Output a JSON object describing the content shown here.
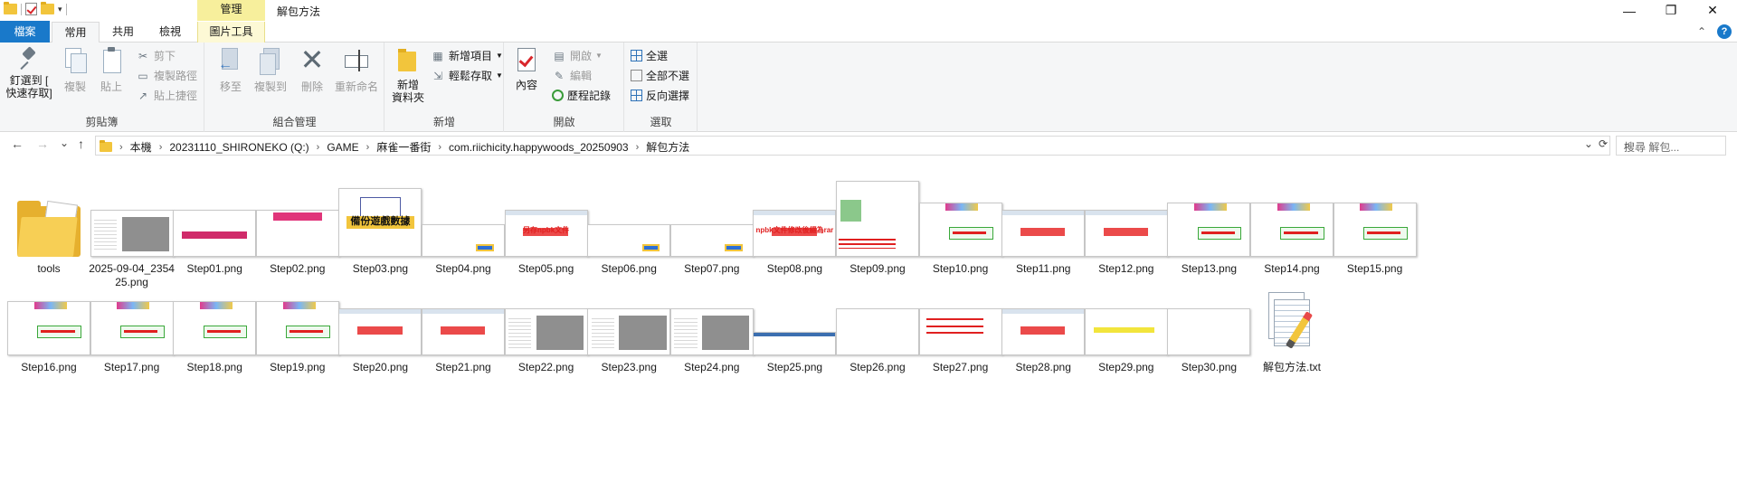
{
  "titlebar": {
    "context_tab": "管理",
    "title": "解包方法",
    "qat_dropdown": "▾",
    "minimize": "—",
    "maximize": "❐",
    "close": "✕"
  },
  "tabs": {
    "file": "檔案",
    "home": "常用",
    "share": "共用",
    "view": "檢視",
    "picture_tools": "圖片工具",
    "collapse": "⌃",
    "help": "?"
  },
  "ribbon": {
    "clipboard": {
      "label": "剪貼簿",
      "pin": "釘選到 [ 快速存取]",
      "copy": "複製",
      "paste": "貼上",
      "cut": "剪下",
      "copy_path": "複製路徑",
      "paste_shortcut": "貼上捷徑"
    },
    "organize": {
      "label": "組合管理",
      "move_to": "移至",
      "copy_to": "複製到",
      "delete": "刪除",
      "rename": "重新命名"
    },
    "new": {
      "label": "新增",
      "new_folder": "新增 資料夾",
      "new_item": "新增項目",
      "easy_access": "輕鬆存取"
    },
    "open": {
      "label": "開啟",
      "properties": "內容",
      "open": "開啟",
      "edit": "編輯",
      "history": "歷程記錄"
    },
    "select": {
      "label": "選取",
      "select_all": "全選",
      "select_none": "全部不選",
      "invert": "反向選擇"
    }
  },
  "address": {
    "back": "←",
    "forward": "→",
    "recent": "⌄",
    "up": "↑",
    "crumbs": [
      "本機",
      "20231110_SHIRONEKO (Q:)",
      "GAME",
      "麻雀一番街",
      "com.riichicity.happywoods_20250903",
      "解包方法"
    ],
    "search_placeholder": "搜尋 解包..."
  },
  "files": [
    {
      "name": "tools",
      "kind": "folder"
    },
    {
      "name": "2025-09-04_235425.png",
      "kind": "gray"
    },
    {
      "name": "Step01.png",
      "kind": "dark"
    },
    {
      "name": "Step02.png",
      "kind": "anime"
    },
    {
      "name": "Step03.png",
      "kind": "navy",
      "caption": "備份遊戲數據"
    },
    {
      "name": "Step04.png",
      "kind": "navy2"
    },
    {
      "name": "Step05.png",
      "kind": "dlg",
      "caption": "另存npbk文件"
    },
    {
      "name": "Step06.png",
      "kind": "navy2"
    },
    {
      "name": "Step07.png",
      "kind": "navy2"
    },
    {
      "name": "Step08.png",
      "kind": "dlg",
      "caption": "npbk文件修改後綴為rar"
    },
    {
      "name": "Step09.png",
      "kind": "tall"
    },
    {
      "name": "Step10.png",
      "kind": "shot"
    },
    {
      "name": "Step11.png",
      "kind": "dlg"
    },
    {
      "name": "Step12.png",
      "kind": "dlg"
    },
    {
      "name": "Step13.png",
      "kind": "shot"
    },
    {
      "name": "Step14.png",
      "kind": "shot"
    },
    {
      "name": "Step15.png",
      "kind": "shot"
    },
    {
      "name": "Step16.png",
      "kind": "shot"
    },
    {
      "name": "Step17.png",
      "kind": "shot"
    },
    {
      "name": "Step18.png",
      "kind": "shot"
    },
    {
      "name": "Step19.png",
      "kind": "shot"
    },
    {
      "name": "Step20.png",
      "kind": "dlg"
    },
    {
      "name": "Step21.png",
      "kind": "dlg"
    },
    {
      "name": "Step22.png",
      "kind": "gray"
    },
    {
      "name": "Step23.png",
      "kind": "gray"
    },
    {
      "name": "Step24.png",
      "kind": "gray"
    },
    {
      "name": "Step25.png",
      "kind": "small"
    },
    {
      "name": "Step26.png",
      "kind": "term3"
    },
    {
      "name": "Step27.png",
      "kind": "term"
    },
    {
      "name": "Step28.png",
      "kind": "dlg"
    },
    {
      "name": "Step29.png",
      "kind": "term2"
    },
    {
      "name": "Step30.png",
      "kind": "term3"
    },
    {
      "name": "解包方法.txt",
      "kind": "txt"
    }
  ]
}
